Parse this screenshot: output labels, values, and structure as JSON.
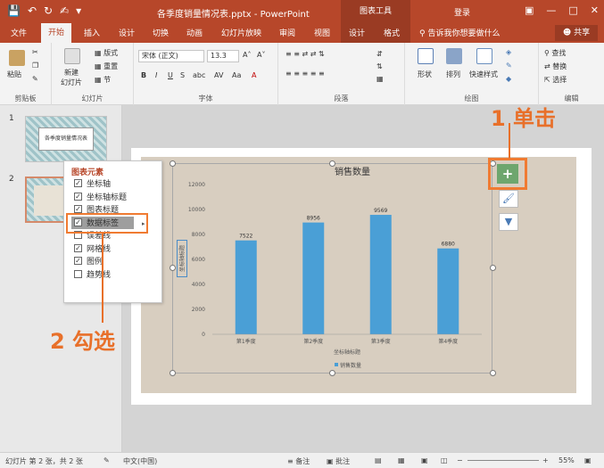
{
  "titlebar": {
    "doc_title": "各季度销量情况表.pptx - PowerPoint",
    "context_label": "图表工具",
    "login": "登录"
  },
  "tabs": [
    "文件",
    "开始",
    "插入",
    "设计",
    "切换",
    "动画",
    "幻灯片放映",
    "审阅",
    "视图",
    "设计",
    "格式"
  ],
  "tellme": "告诉我你想要做什么",
  "share": "共享",
  "ribbon": {
    "groups": [
      "剪贴板",
      "幻灯片",
      "字体",
      "段落",
      "绘图",
      "编辑"
    ],
    "paste": "粘贴",
    "new_slide": "新建\n幻灯片",
    "layout": "版式",
    "reset": "重置",
    "section": "节",
    "font_name": "宋体 (正文)",
    "font_size": "13.3",
    "shapes": "形状",
    "arrange": "排列",
    "quick_styles": "快速样式",
    "find": "查找",
    "replace": "替换",
    "select": "选择"
  },
  "slides": {
    "n1": "1",
    "n2": "2",
    "thumb1_title": "各季度销量情况表"
  },
  "popup": {
    "title": "图表元素",
    "items": [
      {
        "label": "坐标轴",
        "checked": true
      },
      {
        "label": "坐标轴标题",
        "checked": true
      },
      {
        "label": "图表标题",
        "checked": true
      },
      {
        "label": "数据标签",
        "checked": true
      },
      {
        "label": "误差线",
        "checked": false
      },
      {
        "label": "网格线",
        "checked": true
      },
      {
        "label": "图例",
        "checked": true
      },
      {
        "label": "趋势线",
        "checked": false
      }
    ]
  },
  "callouts": {
    "step1": "1 单击",
    "step2": "2 勾选"
  },
  "chart_data": {
    "type": "bar",
    "title": "销售数量",
    "categories": [
      "第1季度",
      "第2季度",
      "第3季度",
      "第4季度"
    ],
    "series": [
      {
        "name": "销售数量",
        "values": [
          7522,
          8956,
          9569,
          6880
        ]
      }
    ],
    "data_labels": [
      "7522",
      "8956",
      "9569",
      "6880"
    ],
    "y_ticks": [
      "0",
      "2000",
      "4000",
      "6000",
      "8000",
      "10000",
      "12000"
    ],
    "ylim": [
      0,
      12000
    ],
    "xlabel": "坐标轴标题",
    "ylabel": "坐标轴标题",
    "legend_position": "bottom",
    "grid": false,
    "colors": {
      "bar": "#4a9fd6",
      "background": "#d8cec0"
    }
  },
  "chart_buttons": {
    "plus": "+"
  },
  "status": {
    "slide_info": "幻灯片 第 2 张，共 2 张",
    "language": "中文(中国)",
    "notes": "备注",
    "comments": "批注",
    "zoom": "55%"
  }
}
